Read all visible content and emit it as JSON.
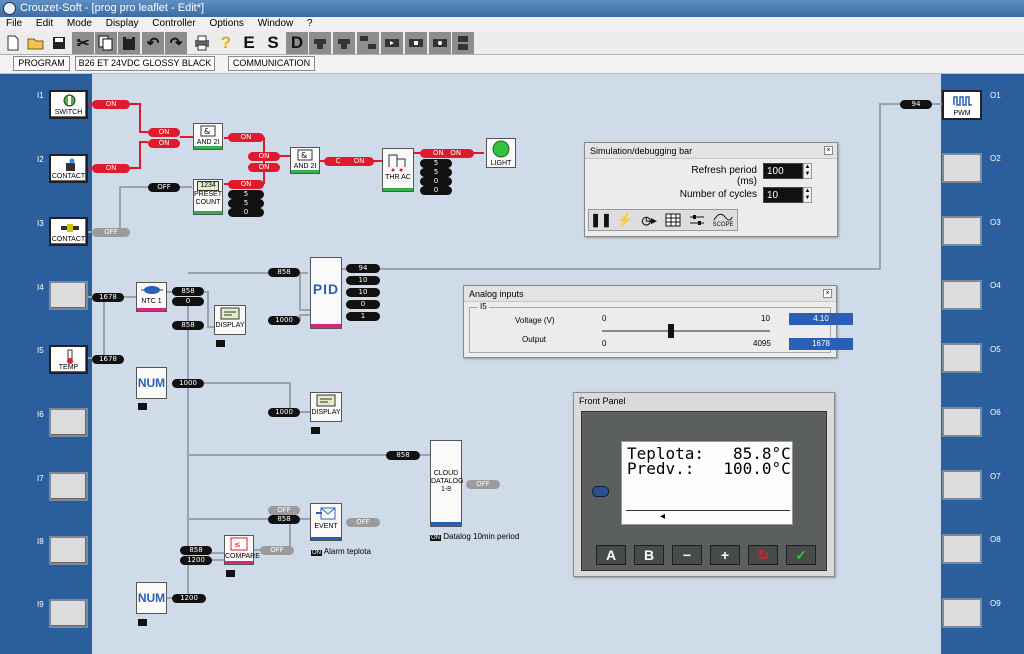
{
  "window": {
    "title": "Crouzet-Soft - [prog pro leaflet - Edit*]"
  },
  "menu": [
    "File",
    "Edit",
    "Mode",
    "Display",
    "Controller",
    "Options",
    "Window",
    "?"
  ],
  "toolbar": {
    "icons": [
      "new-icon",
      "open-icon",
      "save-icon",
      "cut-icon",
      "copy-icon",
      "paste-icon",
      "undo-icon",
      "redo-icon",
      "print-icon",
      "help-icon"
    ],
    "letters": [
      "E",
      "S",
      "D"
    ]
  },
  "tabs": [
    "PROGRAM",
    "B26 ET 24VDC GLOSSY BLACK",
    "COMMUNICATION"
  ],
  "inputs": [
    {
      "label": "I1",
      "block": "SWITCH",
      "active": true
    },
    {
      "label": "I2",
      "block": "CONTACT",
      "active": true
    },
    {
      "label": "I3",
      "block": "CONTACT",
      "active": true
    },
    {
      "label": "I4",
      "block": "",
      "active": false
    },
    {
      "label": "I5",
      "block": "TEMP",
      "active": true
    },
    {
      "label": "I6",
      "block": "",
      "active": false
    },
    {
      "label": "I7",
      "block": "",
      "active": false
    },
    {
      "label": "I8",
      "block": "",
      "active": false
    },
    {
      "label": "I9",
      "block": "",
      "active": false
    }
  ],
  "outputs": [
    {
      "label": "O1",
      "block": "PWM",
      "active": true
    },
    {
      "label": "O2",
      "block": "",
      "active": false
    },
    {
      "label": "O3",
      "block": "",
      "active": false
    },
    {
      "label": "O4",
      "block": "",
      "active": false
    },
    {
      "label": "O5",
      "block": "",
      "active": false
    },
    {
      "label": "O6",
      "block": "",
      "active": false
    },
    {
      "label": "O7",
      "block": "",
      "active": false
    },
    {
      "label": "O8",
      "block": "",
      "active": false
    },
    {
      "label": "O9",
      "block": "",
      "active": false
    }
  ],
  "blocks": {
    "and1": "AND 2I",
    "and2": "AND 2I",
    "preset_count": "PRESET COUNT",
    "preset_digits": "1234",
    "thrac": "THR AC",
    "light": "LIGHT",
    "pid": "PID",
    "ntc": "NTC 1",
    "display1": "DISPLAY",
    "display2": "DISPLAY",
    "num1": "NUM",
    "num2": "NUM",
    "cloud": "CLOUD DATALOG 1-8",
    "event": "EVENT",
    "compare": "COMPARE",
    "alarm_label": "Alarm teplota",
    "datalog_label": "Datalog 10min period",
    "on_tag": "ON"
  },
  "signals": {
    "on": "ON",
    "off": "OFF",
    "c": "C",
    "v94": "94",
    "v10": "10",
    "v0": "0",
    "v1": "1",
    "v5": "5",
    "v858": "858",
    "v1000": "1000",
    "v1678": "1678",
    "v1200": "1200"
  },
  "sim_bar": {
    "title": "Simulation/debugging bar",
    "refresh_label": "Refresh period (ms)",
    "refresh_value": "100",
    "cycles_label": "Number of cycles",
    "cycles_value": "10",
    "scope_label": "SCOPE"
  },
  "analog": {
    "title": "Analog inputs",
    "group": "I5",
    "voltage_label": "Voltage (V)",
    "voltage_min": "0",
    "voltage_max": "10",
    "voltage_value": "4.10",
    "output_label": "Output",
    "output_min": "0",
    "output_max": "4095",
    "output_value": "1678",
    "slider_fraction": 0.41
  },
  "front_panel": {
    "title": "Front Panel",
    "line1": "Teplota:   85.8°C",
    "line2": "Predv.:   100.0°C",
    "buttons": [
      "A",
      "B",
      "−",
      "+",
      "↻",
      "✓"
    ]
  },
  "colors": {
    "accent_blue": "#2b5e9d",
    "canvas": "#cfdbe9",
    "signal_on": "#e11a2b"
  }
}
